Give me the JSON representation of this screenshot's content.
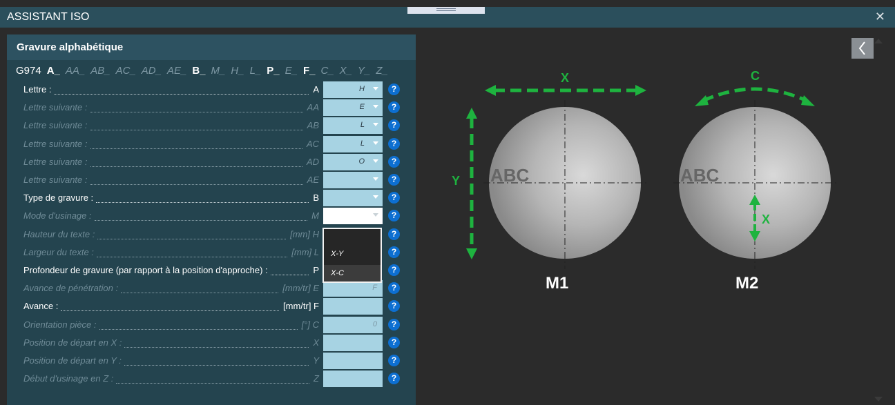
{
  "window": {
    "title": "ASSISTANT ISO",
    "close_icon": "close-icon"
  },
  "panel": {
    "title": "Gravure alphabétique"
  },
  "code_line": [
    {
      "text": "G974",
      "state": "g"
    },
    {
      "text": "A_",
      "state": "on"
    },
    {
      "text": "AA_",
      "state": "off"
    },
    {
      "text": "AB_",
      "state": "off"
    },
    {
      "text": "AC_",
      "state": "off"
    },
    {
      "text": "AD_",
      "state": "off"
    },
    {
      "text": "AE_",
      "state": "off"
    },
    {
      "text": "B_",
      "state": "on"
    },
    {
      "text": "M_",
      "state": "off"
    },
    {
      "text": "H_",
      "state": "off"
    },
    {
      "text": "L_",
      "state": "off"
    },
    {
      "text": "P_",
      "state": "on"
    },
    {
      "text": "E_",
      "state": "off"
    },
    {
      "text": "F_",
      "state": "on"
    },
    {
      "text": "C_",
      "state": "off"
    },
    {
      "text": "X_",
      "state": "off"
    },
    {
      "text": "Y_",
      "state": "off"
    },
    {
      "text": "Z_",
      "state": "off"
    }
  ],
  "rows": [
    {
      "label": "Lettre :",
      "unit": "A",
      "value": "H",
      "kind": "select",
      "active": true
    },
    {
      "label": "Lettre suivante :",
      "unit": "AA",
      "value": "E",
      "kind": "select",
      "active": false
    },
    {
      "label": "Lettre suivante :",
      "unit": "AB",
      "value": "L",
      "kind": "select",
      "active": false
    },
    {
      "label": "Lettre suivante :",
      "unit": "AC",
      "value": "L",
      "kind": "select",
      "active": false
    },
    {
      "label": "Lettre suivante :",
      "unit": "AD",
      "value": "O",
      "kind": "select",
      "active": false
    },
    {
      "label": "Lettre suivante :",
      "unit": "AE",
      "value": "",
      "kind": "select",
      "active": false
    },
    {
      "label": "Type de gravure :",
      "unit": "B",
      "value": "",
      "kind": "select",
      "active": true
    },
    {
      "label": "Mode d'usinage :",
      "unit": "M",
      "value": "",
      "kind": "select-open",
      "active": false
    },
    {
      "label": "Hauteur du texte :",
      "unit": "[mm] H",
      "value": "",
      "kind": "none",
      "active": false
    },
    {
      "label": "Largeur du texte :",
      "unit": "[mm] L",
      "value": "",
      "kind": "none",
      "active": false
    },
    {
      "label": "Profondeur de gravure (par rapport à la position d'approche) :",
      "unit": "P",
      "value": "",
      "kind": "none",
      "active": true
    },
    {
      "label": "Avance de pénétration :",
      "unit": "[mm/tr] E",
      "value": "F",
      "kind": "input",
      "active": false
    },
    {
      "label": "Avance :",
      "unit": "[mm/tr] F",
      "value": "",
      "kind": "input",
      "active": true
    },
    {
      "label": "Orientation pièce :",
      "unit": "[°] C",
      "value": "0",
      "kind": "input",
      "active": false
    },
    {
      "label": "Position de départ en X :",
      "unit": "X",
      "value": "",
      "kind": "input",
      "active": false
    },
    {
      "label": "Position de départ en Y :",
      "unit": "Y",
      "value": "",
      "kind": "input",
      "active": false
    },
    {
      "label": "Début d'usinage en Z :",
      "unit": "Z",
      "value": "",
      "kind": "input",
      "active": false
    }
  ],
  "dropdown": {
    "options": [
      "X-Y",
      "X-C"
    ],
    "highlighted": "X-C"
  },
  "help_label": "?",
  "diagram": {
    "m1_label": "M1",
    "m2_label": "M2",
    "text_sample": "ABC",
    "axis_x": "X",
    "axis_y": "Y",
    "axis_c": "C",
    "axis_x2": "X",
    "arrow_color": "#1eb33f"
  }
}
